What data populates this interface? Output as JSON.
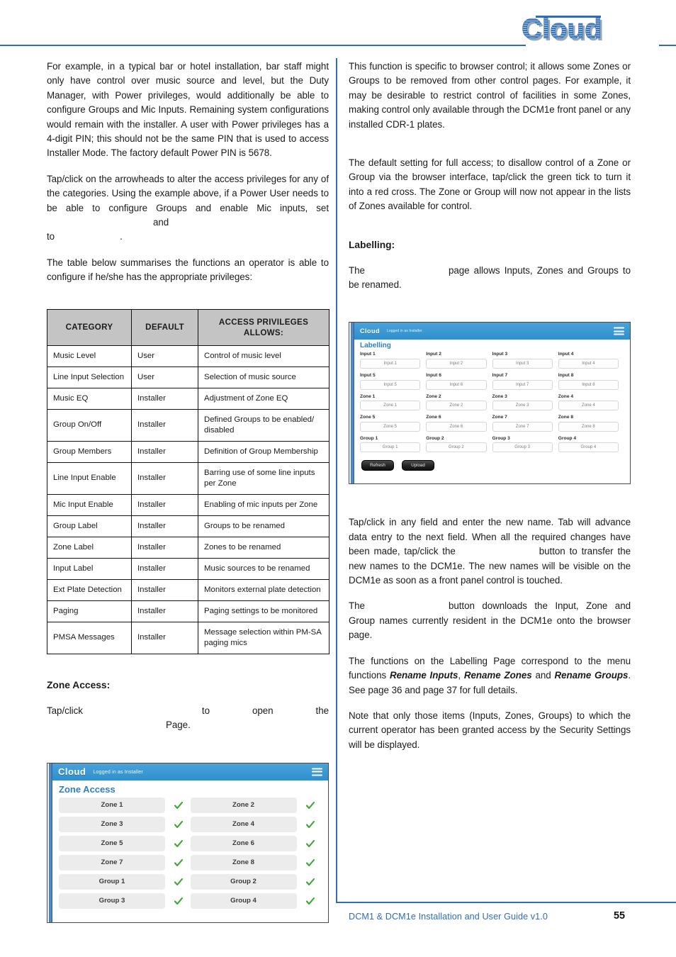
{
  "header": {
    "logo_text": "Cloud",
    "logo_icon": "cloud-brand-logo"
  },
  "left_column": {
    "paragraphs": [
      {
        "id": "p1",
        "parts": [
          "For example, in a typical bar or hotel installation, bar staff might only have control over music source and level, but the Duty Manager, with Power privileges, would additionally be able to configure Groups and Mic Inputs. Remaining system configurations would remain with the installer. A user with Power privileges has a 4-digit PIN; this should not be the same PIN that is used to access Installer Mode. The factory default Power PIN is 5678."
        ]
      },
      {
        "id": "p2",
        "lead": "Tap/click on the arrowheads to alter the access privileges for any of the categories. Using the example above, if a Power User needs to be able to configure Groups and enable Mic inputs, set",
        "mid": "and",
        "tail": "to",
        "end": "."
      },
      {
        "id": "p3",
        "text": "The table below summarises the functions an operator is able to configure if he/she has the appropriate privileges:"
      }
    ],
    "table": {
      "headers": [
        "CATEGORY",
        "DEFAULT",
        "ACCESS PRIVILEGES ALLOWS:"
      ],
      "rows": [
        [
          "Music Level",
          "User",
          "Control of music level"
        ],
        [
          "Line Input Selection",
          "User",
          "Selection of music source"
        ],
        [
          "Music EQ",
          "Installer",
          "Adjustment of Zone EQ"
        ],
        [
          "Group On/Off",
          "Installer",
          "Defined Groups to be enabled/ disabled"
        ],
        [
          "Group Members",
          "Installer",
          "Definition of Group Membership"
        ],
        [
          "Line Input Enable",
          "Installer",
          "Barring use of some line inputs per Zone"
        ],
        [
          "Mic Input Enable",
          "Installer",
          "Enabling of mic inputs per Zone"
        ],
        [
          "Group Label",
          "Installer",
          "Groups to be renamed"
        ],
        [
          "Zone Label",
          "Installer",
          "Zones to be renamed"
        ],
        [
          "Input Label",
          "Installer",
          "Music sources to be renamed"
        ],
        [
          "Ext Plate Detection",
          "Installer",
          "Monitors external plate detection"
        ],
        [
          "Paging",
          "Installer",
          "Paging settings to be monitored"
        ],
        [
          "PMSA Messages",
          "Installer",
          "Message selection within PM-SA paging mics"
        ]
      ]
    },
    "zone_access_heading": "Zone Access:",
    "zone_access_intro": {
      "lead": "Tap/click",
      "mid": "to open the",
      "tail": "Page."
    },
    "zone_access_screenshot": {
      "brand": "Cloud",
      "logged_in": "Logged in as Installer",
      "page_title": "Zone Access",
      "menu_icon": "hamburger-menu-icon",
      "tick_icon": "green-tick-icon",
      "rows": [
        [
          "Zone 1",
          "Zone 2"
        ],
        [
          "Zone 3",
          "Zone 4"
        ],
        [
          "Zone 5",
          "Zone 6"
        ],
        [
          "Zone 7",
          "Zone 8"
        ],
        [
          "Group 1",
          "Group 2"
        ],
        [
          "Group 3",
          "Group 4"
        ]
      ]
    }
  },
  "right_column": {
    "p1": "This function is specific to browser control; it allows some Zones or Groups to be removed from other control pages. For example, it may be desirable to restrict control of facilities in some Zones, making control only available through the DCM1e front panel or any installed CDR-1 plates.",
    "p2": "The default setting for full access; to disallow control of a Zone or Group via the browser interface, tap/click the green tick to turn it into a red cross. The Zone or Group will now not appear in the lists of Zones available for control.",
    "labelling_heading": "Labelling:",
    "labelling_intro": {
      "lead": "The",
      "tail": "page allows Inputs, Zones and Groups to be renamed."
    },
    "labelling_screenshot": {
      "brand": "Cloud",
      "logged_in": "Logged in as Installer",
      "page_title": "Labelling",
      "menu_icon": "hamburger-menu-icon",
      "rows": [
        [
          {
            "label": "Input 1",
            "value": "Input 1"
          },
          {
            "label": "Input 2",
            "value": "Input 2"
          },
          {
            "label": "Input 3",
            "value": "Input 3"
          },
          {
            "label": "Input 4",
            "value": "Input 4"
          }
        ],
        [
          {
            "label": "Input 5",
            "value": "Input 5"
          },
          {
            "label": "Input 6",
            "value": "Input 6"
          },
          {
            "label": "Input 7",
            "value": "Input 7"
          },
          {
            "label": "Input 8",
            "value": "Input 8"
          }
        ],
        [
          {
            "label": "Zone 1",
            "value": "Zone 1"
          },
          {
            "label": "Zone 2",
            "value": "Zone 2"
          },
          {
            "label": "Zone 3",
            "value": "Zone 3"
          },
          {
            "label": "Zone 4",
            "value": "Zone 4"
          }
        ],
        [
          {
            "label": "Zone 5",
            "value": "Zone 5"
          },
          {
            "label": "Zone 6",
            "value": "Zone 6"
          },
          {
            "label": "Zone 7",
            "value": "Zone 7"
          },
          {
            "label": "Zone 8",
            "value": "Zone 8"
          }
        ],
        [
          {
            "label": "Group 1",
            "value": "Group 1"
          },
          {
            "label": "Group 2",
            "value": "Group 2"
          },
          {
            "label": "Group 3",
            "value": "Group 3"
          },
          {
            "label": "Group 4",
            "value": "Group 4"
          }
        ]
      ],
      "refresh_label": "Refresh",
      "upload_label": "Upload"
    },
    "p3": {
      "lead": "Tap/click in any field and enter the new name. Tab will advance data entry to the next field. When all the required changes have been made, tap/click the",
      "tail": "button to transfer the new names to the DCM1e. The new names will be visible on the DCM1e as soon as a front panel control is touched."
    },
    "p4": {
      "lead": "The",
      "tail": "button downloads the Input, Zone and Group names currently resident in the DCM1e onto the browser page."
    },
    "p5": {
      "lead": "The functions on the Labelling Page correspond to the menu functions",
      "b1": "Rename Inputs",
      "sep1": ",",
      "b2": "Rename Zones",
      "sep2": "and",
      "b3": "Rename Groups",
      "tail": ". See page 36 and page 37 for full details."
    },
    "p6": "Note that only those items (Inputs, Zones, Groups) to which the current operator has been granted access by the Security Settings will be displayed."
  },
  "footer": {
    "title": "DCM1 & DCM1e Installation and User Guide v1.0",
    "page_number": "55"
  },
  "colors": {
    "brand_blue": "#2f6eb5",
    "ui_blue": "#2e8fce",
    "tick_green": "#3aa832",
    "table_header_grey": "#c4c4c4"
  }
}
